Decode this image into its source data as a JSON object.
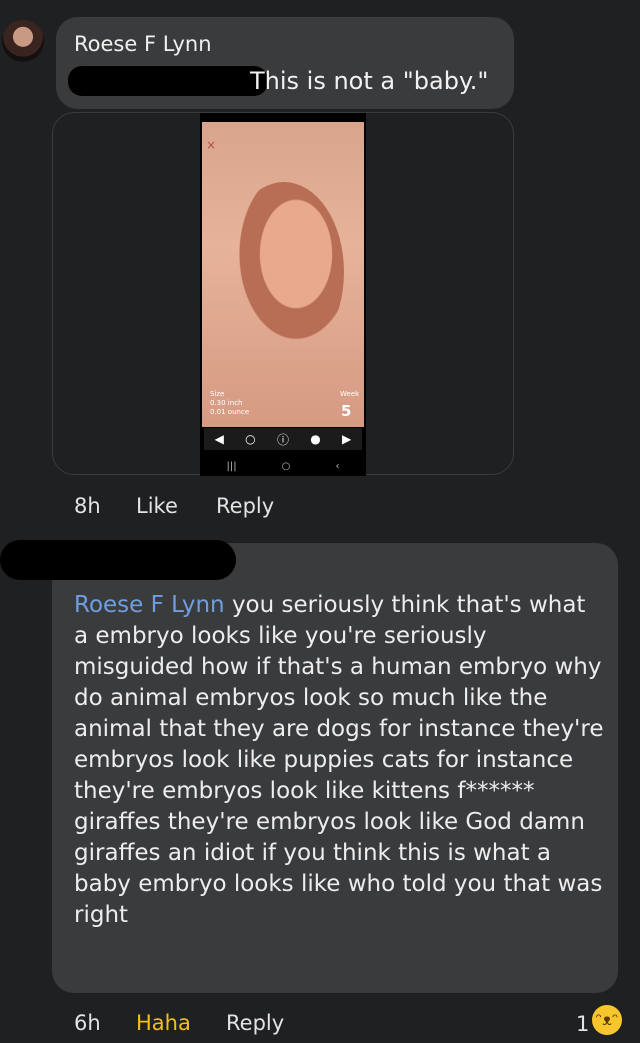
{
  "comment1": {
    "author": "Roese F Lynn",
    "text": "This is not a \"baby.\"",
    "time": "8h",
    "like_label": "Like",
    "reply_label": "Reply",
    "media": {
      "close_icon": "×",
      "size_label": "Size",
      "size_inch": "0.30 inch",
      "size_ounce": "0.01 ounce",
      "week_label": "Week",
      "week_number": "5"
    }
  },
  "comment2": {
    "mention": "Roese F Lynn",
    "text": "you seriously think that's what a embryo looks like you're seriously misguided how if that's a human embryo why do animal embryos look so much like the animal that they are dogs for instance they're embryos look like puppies cats for instance they're embryos look like kittens f****** giraffes they're embryos look like God damn giraffes an idiot if you think this is what a baby embryo looks like who told you that was right",
    "time": "6h",
    "reaction_label": "Haha",
    "reply_label": "Reply",
    "reaction_count": "1"
  },
  "colors": {
    "mention": "#6f9fe0",
    "haha": "#f3c018",
    "bubble": "#3a3b3d",
    "background": "#1f2022"
  }
}
